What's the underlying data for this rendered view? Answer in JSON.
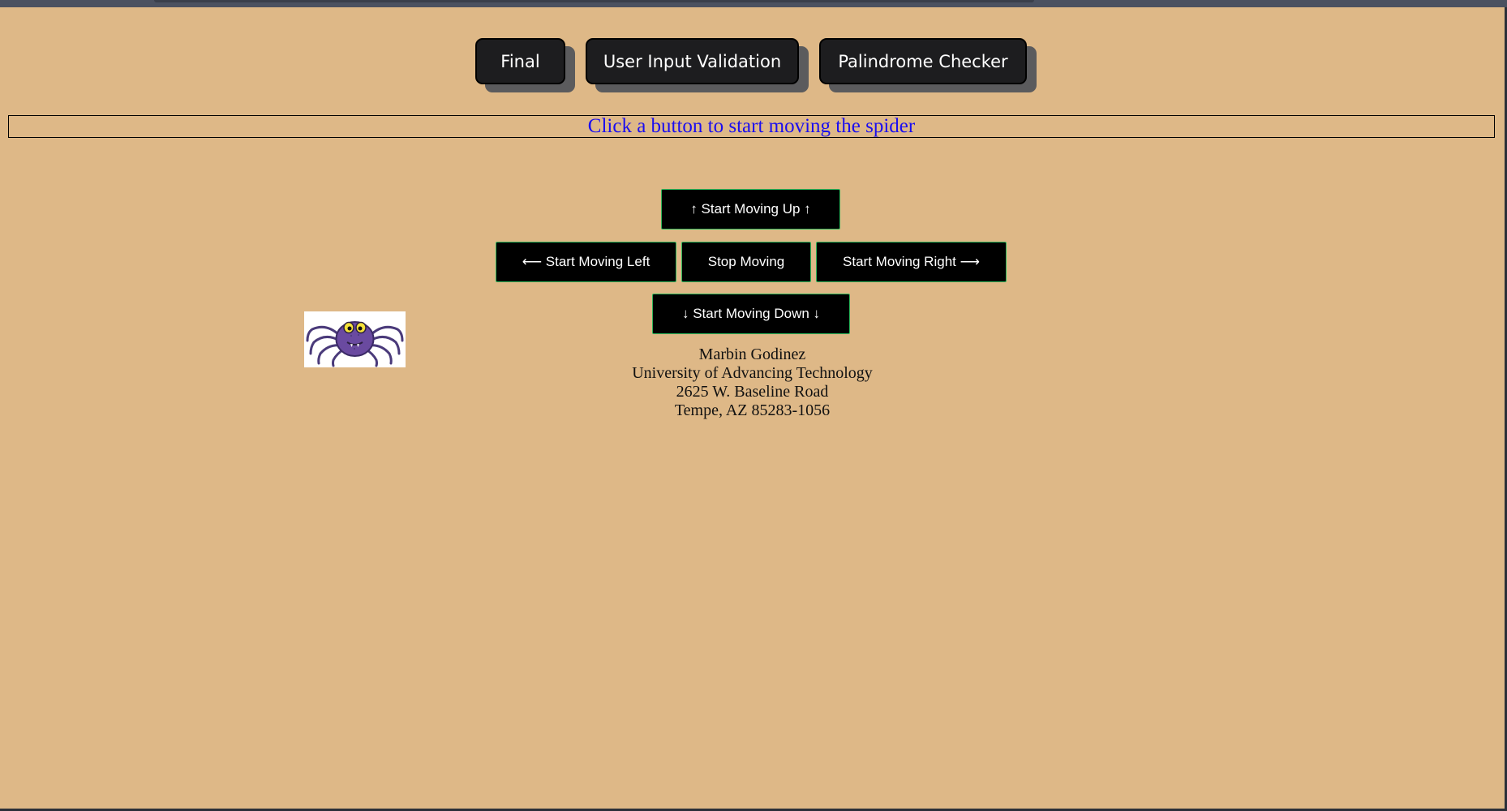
{
  "nav": {
    "items": [
      {
        "label": "Final"
      },
      {
        "label": "User Input Validation"
      },
      {
        "label": "Palindrome Checker"
      }
    ]
  },
  "status": {
    "message": "Click a button to start moving the spider"
  },
  "controls": {
    "up": "↑ Start Moving Up ↑",
    "left": "⟵ Start Moving Left",
    "stop": "Stop Moving",
    "right": "Start Moving Right ⟶",
    "down": "↓ Start Moving Down ↓"
  },
  "spider": {
    "icon": "spider-icon"
  },
  "contact": {
    "name": "Marbin Godinez",
    "school": "University of Advancing Technology",
    "street": "2625 W. Baseline Road",
    "city": "Tempe, AZ 85283-1056"
  },
  "colors": {
    "page_background": "#deb887",
    "status_text": "#1a0df0",
    "nav_button": "#1d1d1f",
    "control_button": "#000000",
    "control_border": "#2db55a",
    "spider_body": "#6a4aa0"
  }
}
